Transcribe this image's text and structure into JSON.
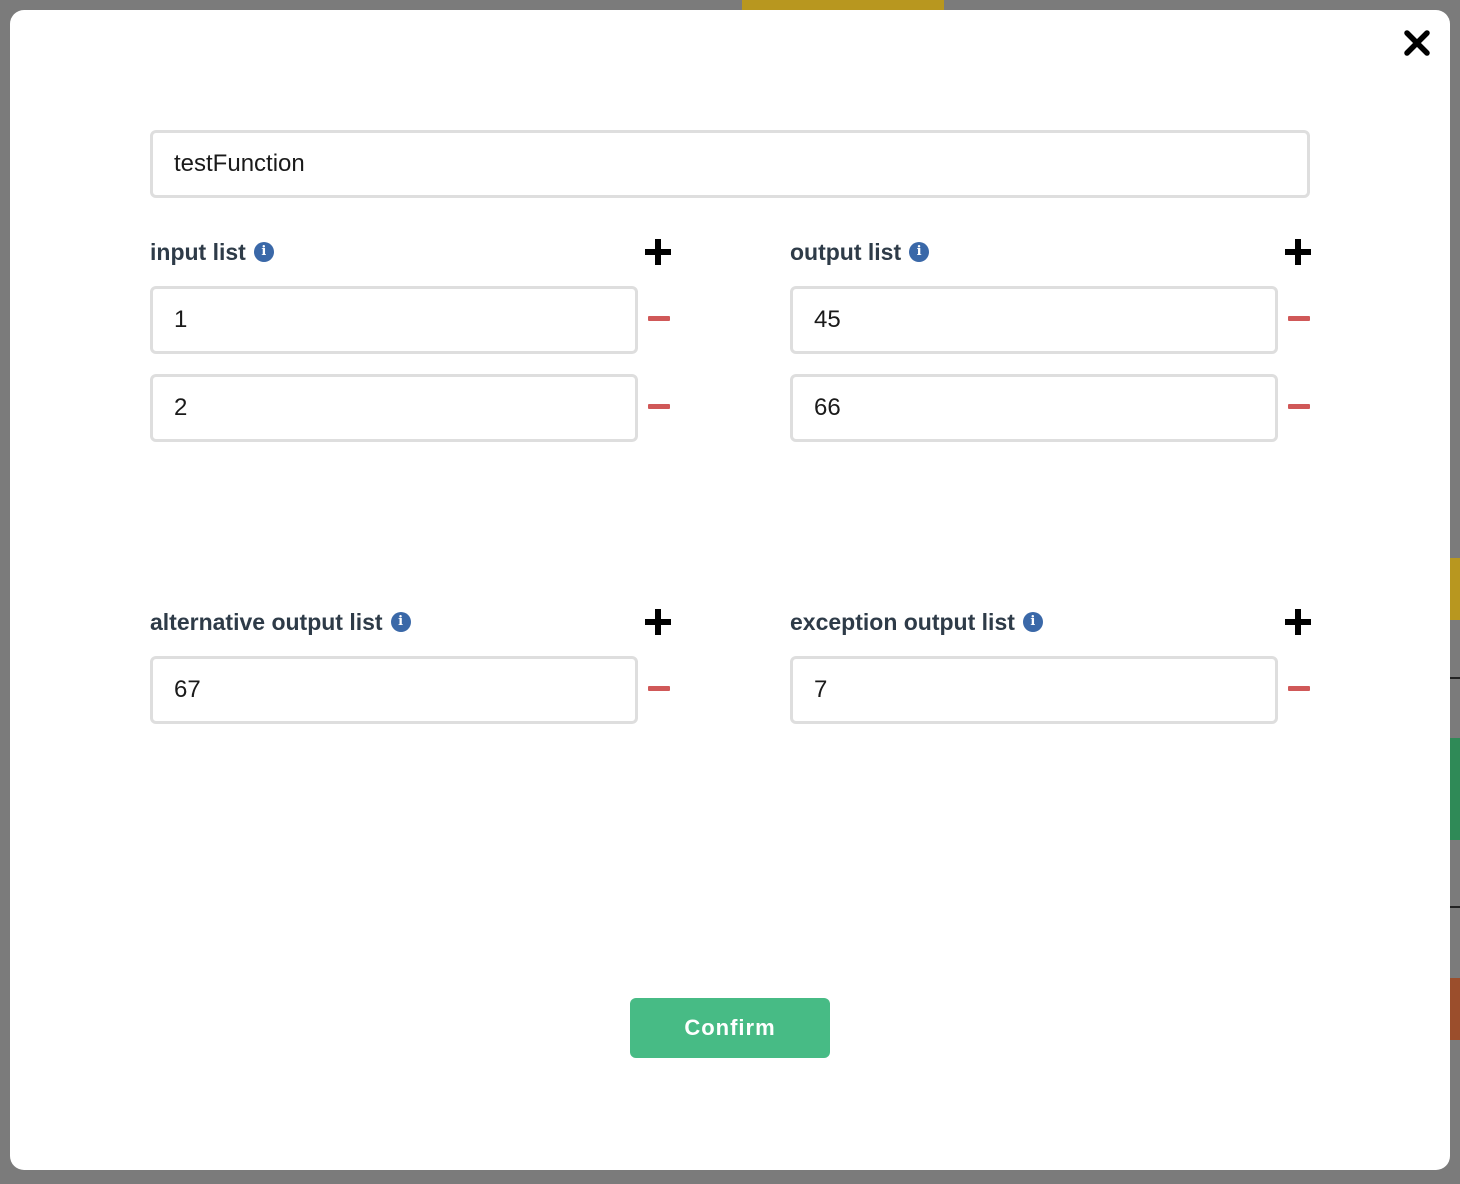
{
  "dialog": {
    "function_name": "testFunction",
    "confirm_label": "Confirm",
    "colors": {
      "confirm_bg": "#47bb85",
      "info_icon": "#3a68a8",
      "remove_icon": "#d05858",
      "label_text": "#2e3b48"
    },
    "icons": {
      "close": "close-icon",
      "info": "info-icon",
      "add": "plus-icon",
      "remove": "minus-icon"
    }
  },
  "sections": {
    "input": {
      "label": "input list",
      "info_glyph": "i",
      "items": [
        "1",
        "2"
      ]
    },
    "output": {
      "label": "output list",
      "info_glyph": "i",
      "items": [
        "45",
        "66"
      ]
    },
    "alternative": {
      "label": "alternative output list",
      "info_glyph": "i",
      "items": [
        "67"
      ]
    },
    "exception": {
      "label": "exception output list",
      "info_glyph": "i",
      "items": [
        "7"
      ]
    }
  }
}
